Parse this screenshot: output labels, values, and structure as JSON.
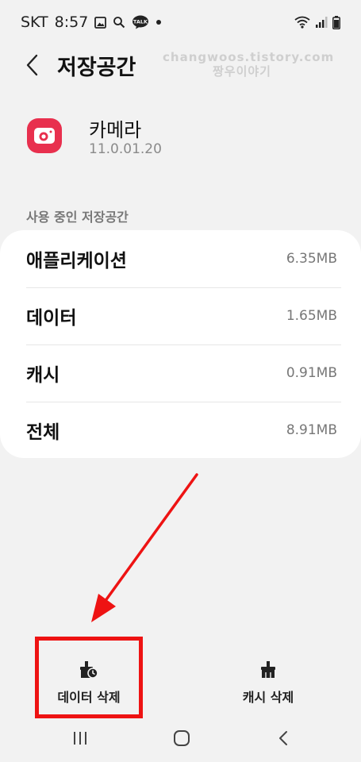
{
  "status_bar": {
    "carrier": "SKT",
    "time": "8:57",
    "kakao_badge": "TALK"
  },
  "header": {
    "title": "저장공간"
  },
  "watermark": {
    "line1": "changwoos.tistory.com",
    "line2": "짱우이야기"
  },
  "app": {
    "name": "카메라",
    "version": "11.0.01.20",
    "icon": "camera-icon",
    "icon_color": "#e8304e"
  },
  "storage": {
    "section_label": "사용 중인 저장공간",
    "rows": [
      {
        "label": "애플리케이션",
        "value": "6.35MB"
      },
      {
        "label": "데이터",
        "value": "1.65MB"
      },
      {
        "label": "캐시",
        "value": "0.91MB"
      },
      {
        "label": "전체",
        "value": "8.91MB"
      }
    ]
  },
  "actions": {
    "clear_data": {
      "label": "데이터 삭제",
      "icon": "clear-data-icon"
    },
    "clear_cache": {
      "label": "캐시 삭제",
      "icon": "clear-cache-icon"
    }
  },
  "annotation": {
    "color": "#ee1313"
  }
}
